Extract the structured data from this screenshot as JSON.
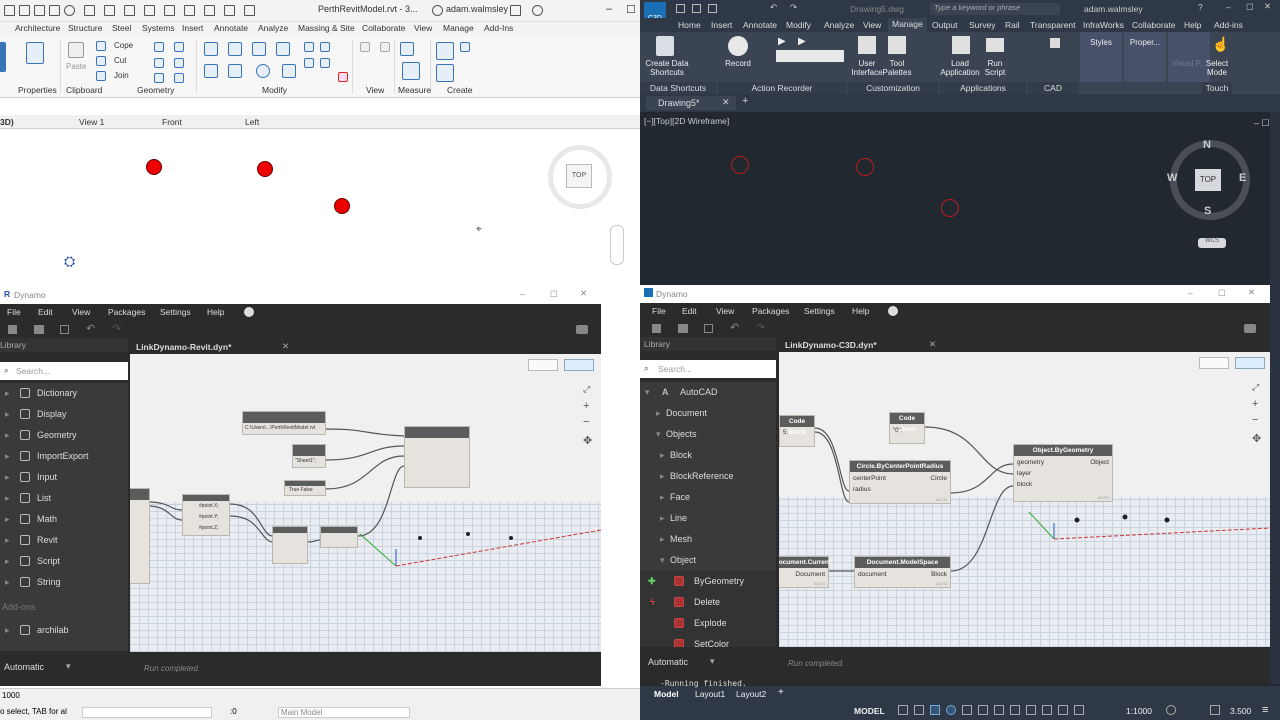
{
  "revit": {
    "title": "PerthRevitModel.rvt - 3...",
    "user": "adam.walmsley",
    "tabs": [
      "Architecture",
      "Structure",
      "Steel",
      "Systems",
      "Insert",
      "Annotate",
      "Analyze",
      "Massing & Site",
      "Collaborate",
      "View",
      "Manage",
      "Add-Ins"
    ],
    "ribbon": {
      "groups": [
        "Properties",
        "Clipboard",
        "Geometry",
        "Modify",
        "View",
        "Measure",
        "Create"
      ],
      "cope": "Cope",
      "cut": "Cut",
      "join": "Join",
      "paste": "Paste"
    },
    "view_tabs": [
      "3D)",
      "View 1",
      "Front",
      "Left"
    ],
    "viewcube": "TOP",
    "status": {
      "scale": "1000",
      "hint": "o select, TAB for al",
      "coord": ":0",
      "model": "Main Model"
    }
  },
  "dynamo_left": {
    "app": "Dynamo",
    "menu": [
      "File",
      "Edit",
      "View",
      "Packages",
      "Settings",
      "Help"
    ],
    "library_label": "Library",
    "search_placeholder": "Search...",
    "file_tab": "LinkDynamo-Revit.dyn*",
    "library_items": [
      "Dictionary",
      "Display",
      "Geometry",
      "ImportExport",
      "Input",
      "List",
      "Math",
      "Revit",
      "Script",
      "String"
    ],
    "addons": "Add-ons",
    "addon_items": [
      "archilab"
    ],
    "run_mode": "Automatic",
    "run_status": "Run completed.",
    "node_texts": {
      "path": "C:\\Users\\...\\PerthRevitModel.rvt",
      "sheet": "\"Sheet1\";",
      "bool": "True  False",
      "pts": [
        "#point.X;",
        "#point.Y;",
        "#point.Z;"
      ]
    }
  },
  "c3d": {
    "title": "Drawing5.dwg",
    "search_placeholder": "Type a keyword or phrase",
    "user": "adam.walmsley",
    "tabs": [
      "Home",
      "Insert",
      "Annotate",
      "Modify",
      "Analyze",
      "View",
      "Manage",
      "Output",
      "Survey",
      "Rail",
      "Transparent",
      "InfraWorks",
      "Collaborate",
      "Help",
      "Add-ins"
    ],
    "active_tab": "Manage",
    "ribbon_buttons": [
      "Create Data Shortcuts",
      "Record",
      "User Interface",
      "Tool Palettes",
      "Load Application",
      "Run Script",
      "Styles",
      "Proper...",
      "Visual P...",
      "Select Mode"
    ],
    "ribbon_groups": [
      "Data Shortcuts",
      "Action Recorder",
      "Customization",
      "Applications",
      "CAD Standards",
      "Touch"
    ],
    "file_tab": "Drawing5*",
    "viewport_label": "[−][Top][2D Wireframe]",
    "compass": {
      "n": "N",
      "s": "S",
      "e": "E",
      "w": "W",
      "face": "TOP",
      "wcs": "WCS"
    },
    "command_line": "-Running finished.",
    "layout_tabs": [
      "Model",
      "Layout1",
      "Layout2"
    ],
    "status": {
      "model": "MODEL",
      "scale": "1:1000",
      "value": "3.500"
    }
  },
  "dynamo_right": {
    "app": "Dynamo",
    "menu": [
      "File",
      "Edit",
      "View",
      "Packages",
      "Settings",
      "Help"
    ],
    "library_label": "Library",
    "search_placeholder": "Search...",
    "file_tab": "LinkDynamo-C3D.dyn*",
    "library_tree": [
      {
        "label": "AutoCAD",
        "level": 0
      },
      {
        "label": "Document",
        "level": 1
      },
      {
        "label": "Objects",
        "level": 1
      },
      {
        "label": "Block",
        "level": 2
      },
      {
        "label": "BlockReference",
        "level": 2
      },
      {
        "label": "Face",
        "level": 2
      },
      {
        "label": "Line",
        "level": 2
      },
      {
        "label": "Mesh",
        "level": 2
      },
      {
        "label": "Object",
        "level": 2
      },
      {
        "label": "ByGeometry",
        "level": 3
      },
      {
        "label": "Delete",
        "level": 3
      },
      {
        "label": "Explode",
        "level": 3
      },
      {
        "label": "SetColor",
        "level": 3
      }
    ],
    "nodes": {
      "cb1": "Code Block",
      "cb1_val": "5;",
      "cb2": "Code Block",
      "cb2_val": "\"0\";",
      "circle": "Circle.ByCenterPointRadius",
      "circle_in": [
        "centerPoint",
        "radius"
      ],
      "circle_out": "Circle",
      "obj": "Object.ByGeometry",
      "obj_in": [
        "geometry",
        "layer",
        "block"
      ],
      "obj_out": "Object",
      "doc": "Document.Current",
      "doc_out": "Document",
      "ms": "Document.ModelSpace",
      "ms_in": "document",
      "ms_out": "Block",
      "auto": "AUTO"
    },
    "run_mode": "Automatic",
    "run_status": "Run completed."
  }
}
